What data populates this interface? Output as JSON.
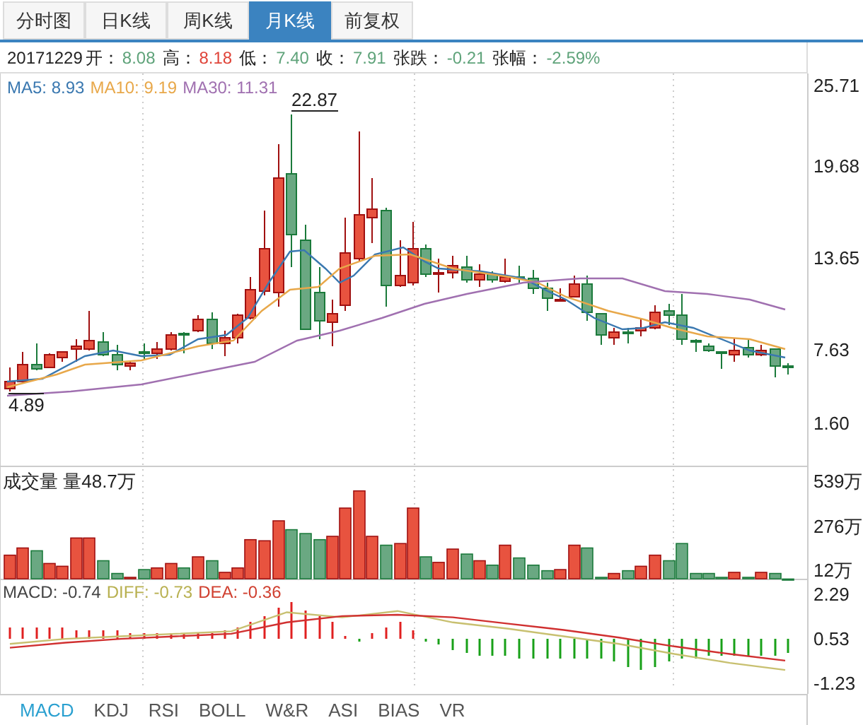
{
  "tabs": [
    {
      "label": "分时图",
      "selected": false
    },
    {
      "label": "日K线",
      "selected": false
    },
    {
      "label": "周K线",
      "selected": false
    },
    {
      "label": "月K线",
      "selected": true
    },
    {
      "label": "前复权",
      "selected": false
    }
  ],
  "quote": {
    "date": "20171229",
    "fields": [
      {
        "label": "开：",
        "value": "8.08",
        "color": "#5fa37a"
      },
      {
        "label": "高：",
        "value": "8.18",
        "color": "#e0453a"
      },
      {
        "label": "低：",
        "value": "7.40",
        "color": "#5fa37a"
      },
      {
        "label": "收：",
        "value": "7.91",
        "color": "#5fa37a"
      },
      {
        "label": "张跌：",
        "value": "-0.21",
        "color": "#5fa37a"
      },
      {
        "label": "张幅：",
        "value": "-2.59%",
        "color": "#5fa37a"
      }
    ]
  },
  "ma_legend": [
    {
      "label": "MA5: 8.93",
      "color": "#3a78b0"
    },
    {
      "label": "MA10: 9.19",
      "color": "#e8a84a"
    },
    {
      "label": "MA30: 11.31",
      "color": "#a070b0"
    }
  ],
  "price_axis": [
    "25.71",
    "19.68",
    "13.65",
    "7.63",
    "1.60"
  ],
  "price_high": "22.87",
  "price_low": "4.89",
  "volume": {
    "label": "成交量 量48.7万",
    "axis": [
      "539万",
      "276万",
      "12万"
    ]
  },
  "macd_legend": [
    {
      "label": "MACD: -0.74",
      "color": "#444444"
    },
    {
      "label": ": -0.73",
      "color": "#b8b050"
    },
    {
      "label": ": -0.36",
      "color": "#d04030"
    }
  ],
  "macd": {
    "chart_data": {
      "type": "line",
      "categories": [
        null,
        null,
        null,
        null,
        null,
        null,
        null,
        null,
        null,
        null,
        null,
        null,
        null,
        null,
        null
      ],
      "ylim": [
        -1.23,
        2.29
      ],
      "yticks": [
        {
          "value": 2.29,
          "label": "2.29"
        },
        {
          "value": 0.53,
          "label": "0.53"
        },
        {
          "value": -1.23,
          "label": "-1.23"
        }
      ],
      "series": [
        {
          "name": "DIFF",
          "color": "#c8c070",
          "values": [
            0.3,
            0.5,
            0.6,
            0.7,
            0.8,
            1.55,
            1.35,
            1.6,
            1.15,
            0.9,
            0.6,
            0.3,
            -0.1,
            -0.45,
            -0.73
          ]
        },
        {
          "name": "DEA",
          "color": "#d03030",
          "values": [
            0.15,
            0.35,
            0.5,
            0.6,
            0.7,
            1.15,
            1.4,
            1.45,
            1.35,
            1.1,
            0.85,
            0.55,
            0.2,
            -0.1,
            -0.36
          ]
        }
      ]
    }
  },
  "indicators": [
    {
      "label": "MACD",
      "selected": true
    },
    {
      "label": "KDJ",
      "selected": false
    },
    {
      "label": "RSI",
      "selected": false
    },
    {
      "label": "BOLL",
      "selected": false
    },
    {
      "label": "W&R",
      "selected": false
    },
    {
      "label": "ASI",
      "selected": false
    },
    {
      "label": "BIAS",
      "selected": false
    },
    {
      "label": "VR",
      "selected": false
    }
  ]
}
